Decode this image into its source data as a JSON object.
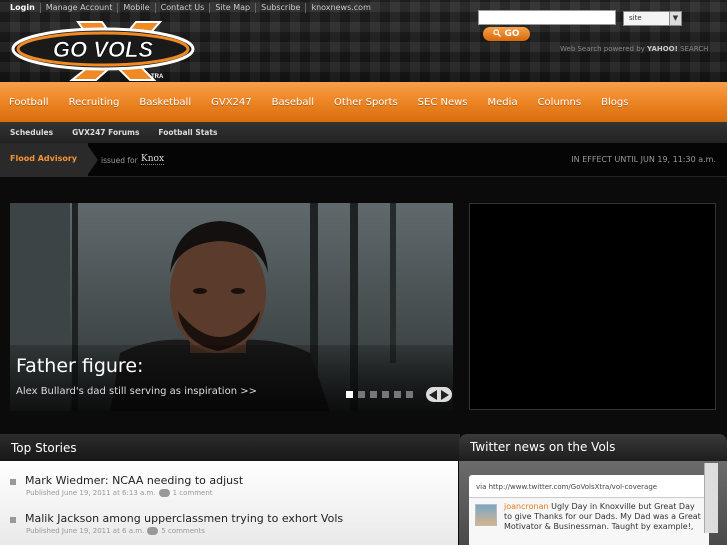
{
  "header": {
    "toplinks": [
      "Login",
      "Manage Account",
      "Mobile",
      "Contact Us",
      "Site Map",
      "Subscribe",
      "knoxnews.com"
    ],
    "logo_text": "GO VOLS",
    "logo_badge": "X",
    "logo_badge_sub": "TRA",
    "search": {
      "placeholder": "",
      "scope": "site",
      "go_label": "GO",
      "powered_by_prefix": "Web Search powered by",
      "powered_by_brand": "YAHOO!",
      "powered_by_suffix": "SEARCH"
    }
  },
  "nav": {
    "items": [
      "Football",
      "Recruiting",
      "Basketball",
      "GVX247",
      "Baseball",
      "Other Sports",
      "SEC News",
      "Media",
      "Columns",
      "Blogs"
    ]
  },
  "subnav": {
    "items": [
      "Schedules",
      "GVX247 Forums",
      "Football Stats"
    ]
  },
  "advisory": {
    "label": "Flood Advisory",
    "issued_for": "issued for",
    "place": "Knox",
    "effect": "IN EFFECT UNTIL JUN 19, 11:30 a.m."
  },
  "hero": {
    "title": "Father figure:",
    "subtitle": "Alex Bullard's dad still serving as inspiration >>",
    "slide_count": 6,
    "active_slide": 1
  },
  "top_stories": {
    "title": "Top Stories",
    "items": [
      {
        "headline": "Mark Wiedmer: NCAA needing to adjust",
        "published": "Published June 19, 2011 at 6:13 a.m.",
        "comments": "1 comment"
      },
      {
        "headline": "Malik Jackson among upperclassmen trying to exhort Vols",
        "published": "Published June 19, 2011 at 6 a.m.",
        "comments": "5 comments"
      }
    ]
  },
  "twitter": {
    "title": "Twitter news on the Vols",
    "via": "via http://www.twitter.com/GoVolsXtra/vol-coverage",
    "tweet": {
      "user": "joancronan",
      "text": " Ugly Day in Knoxville but Great Day to give Thanks for our Dads. My Dad was a Great Motivator & Businessman. Taught by example!,"
    }
  },
  "colors": {
    "accent": "#ee8727",
    "accent_dark": "#d96d0c",
    "advisory_text": "#f49532",
    "background": "#0b0b0b"
  }
}
